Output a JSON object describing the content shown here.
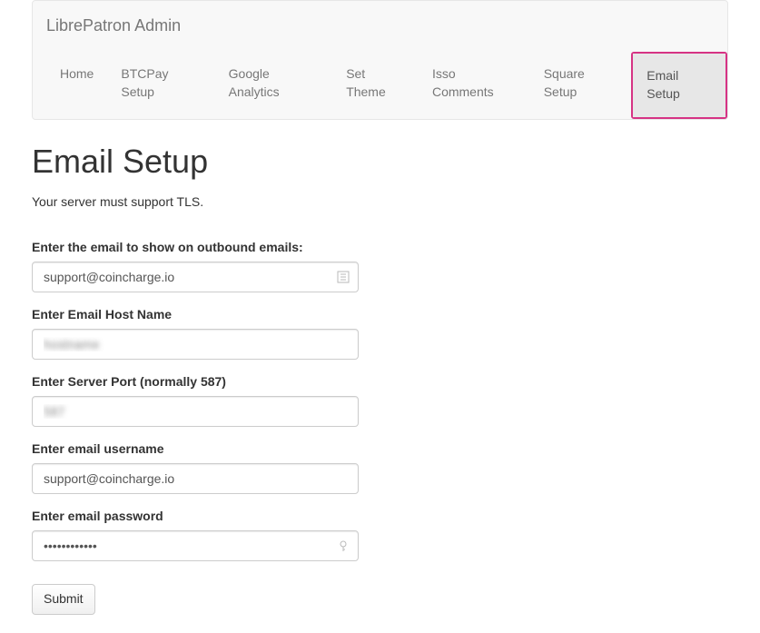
{
  "navbar": {
    "brand": "LibrePatron Admin",
    "items": [
      {
        "label": "Home"
      },
      {
        "label": "BTCPay Setup"
      },
      {
        "label": "Google Analytics"
      },
      {
        "label": "Set Theme"
      },
      {
        "label": "Isso Comments"
      },
      {
        "label": "Square Setup"
      },
      {
        "label": "Email Setup"
      }
    ]
  },
  "page": {
    "title": "Email Setup",
    "subtitle": "Your server must support TLS."
  },
  "form": {
    "email_label": "Enter the email to show on outbound emails:",
    "email_value": "support@coincharge.io",
    "host_label": "Enter Email Host Name",
    "host_value": "hostname",
    "port_label": "Enter Server Port (normally 587)",
    "port_value": "587",
    "username_label": "Enter email username",
    "username_value": "support@coincharge.io",
    "password_label": "Enter email password",
    "password_value": "••••••••••••",
    "submit_label": "Submit"
  }
}
